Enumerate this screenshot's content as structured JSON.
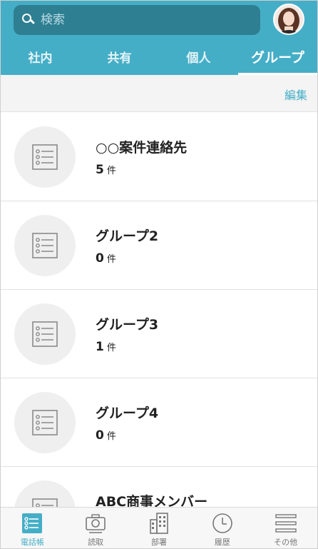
{
  "search": {
    "placeholder": "検索"
  },
  "tabs": [
    {
      "label": "社内",
      "active": false
    },
    {
      "label": "共有",
      "active": false
    },
    {
      "label": "個人",
      "active": false
    },
    {
      "label": "グループ",
      "active": true
    }
  ],
  "toolbar": {
    "edit_label": "編集"
  },
  "groups": [
    {
      "name": "○○案件連絡先",
      "count": "5",
      "unit": "件"
    },
    {
      "name": "グループ2",
      "count": "0",
      "unit": "件"
    },
    {
      "name": "グループ3",
      "count": "1",
      "unit": "件"
    },
    {
      "name": "グループ4",
      "count": "0",
      "unit": "件"
    },
    {
      "name": "ABC商事メンバー",
      "count": "",
      "unit": ""
    }
  ],
  "bottom_nav": [
    {
      "label": "電話帳",
      "icon": "phonebook-icon",
      "active": true
    },
    {
      "label": "読取",
      "icon": "camera-icon",
      "active": false
    },
    {
      "label": "部署",
      "icon": "building-icon",
      "active": false
    },
    {
      "label": "履歴",
      "icon": "clock-icon",
      "active": false
    },
    {
      "label": "その他",
      "icon": "menu-icon",
      "active": false
    }
  ],
  "colors": {
    "accent": "#45aec7",
    "search_bg": "#2f7f92",
    "list_bg": "#ffffff"
  }
}
